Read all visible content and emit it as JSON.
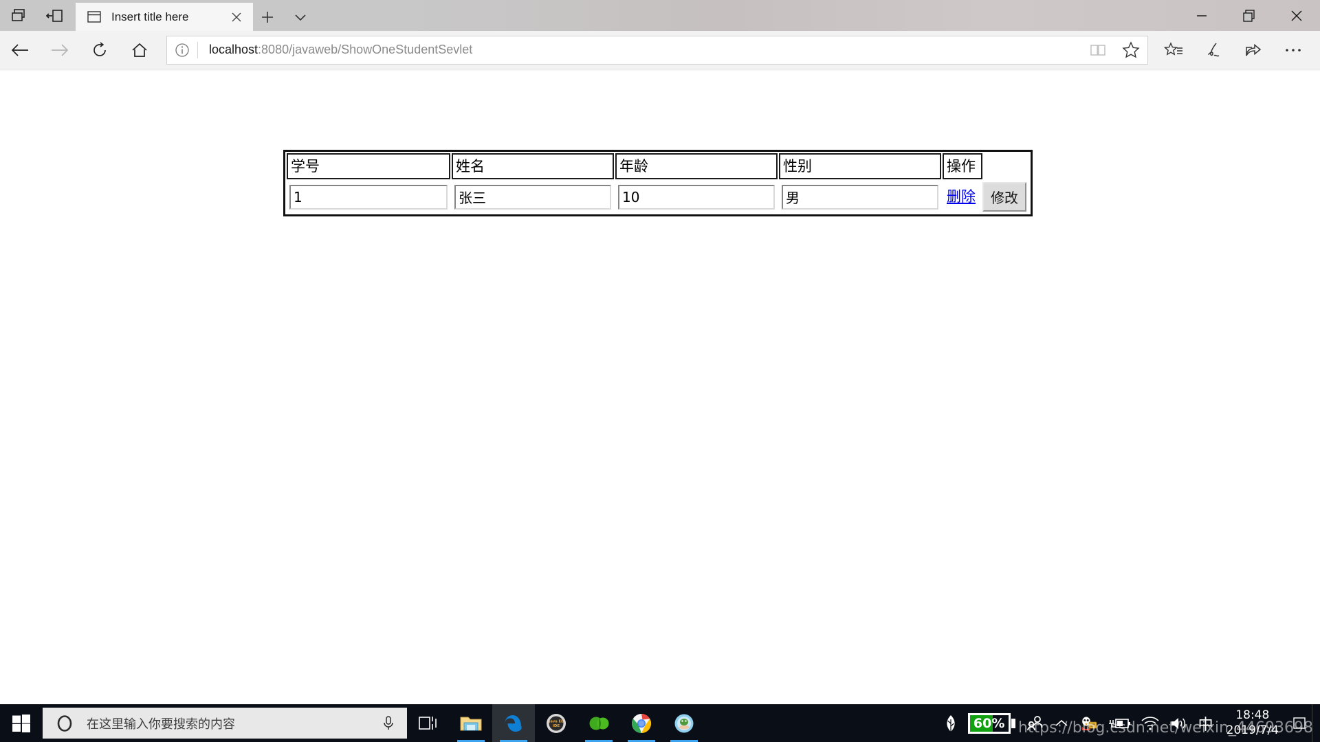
{
  "window": {
    "tab_title": "Insert title here",
    "controls": {
      "minimize": "—",
      "restore": "❐",
      "close": "✕"
    }
  },
  "toolbar": {
    "back": "back-arrow",
    "forward": "forward-arrow",
    "refresh": "refresh",
    "home": "home",
    "reading_view": "reading-view",
    "favorite": "favorite-star",
    "hub": "hub-star-list",
    "web_note": "web-note-pen",
    "share": "share",
    "settings": "more-settings"
  },
  "address": {
    "host": "localhost",
    "path": ":8080/javaweb/ShowOneStudentSevlet",
    "full_url": "localhost:8080/javaweb/ShowOneStudentSevlet"
  },
  "page": {
    "table": {
      "headers": [
        "学号",
        "姓名",
        "年龄",
        "性别",
        "操作"
      ],
      "row": {
        "id": "1",
        "name": "张三",
        "age": "10",
        "gender": "男",
        "delete_label": "删除",
        "modify_label": "修改"
      }
    }
  },
  "taskbar": {
    "search_placeholder": "在这里输入你要搜索的内容",
    "apps": [
      {
        "name": "task-view",
        "label": "Task View",
        "active": false
      },
      {
        "name": "file-explorer",
        "label": "File Explorer",
        "active": false
      },
      {
        "name": "microsoft-edge",
        "label": "Microsoft Edge",
        "active": true
      },
      {
        "name": "java-ee-ide",
        "label": "Java EE IDE",
        "active": false
      },
      {
        "name": "navicat",
        "label": "Navicat",
        "active": false
      },
      {
        "name": "google-chrome",
        "label": "Google Chrome",
        "active": false
      },
      {
        "name": "apache-tomcat",
        "label": "Apache Tomcat",
        "active": false
      }
    ],
    "battery_percent": "60%",
    "battery_level": 60,
    "ime": "中",
    "time": "18:48",
    "date": "2019/7/4"
  },
  "watermark": "https://blog.csdn.net/weixin_44693698",
  "colors": {
    "link_blue": "#0000ee",
    "battery_green": "#10a010",
    "taskbar_bg": "#0a0e17",
    "edge_blue": "#0f7fd4",
    "active_underline": "#3da4f0"
  }
}
